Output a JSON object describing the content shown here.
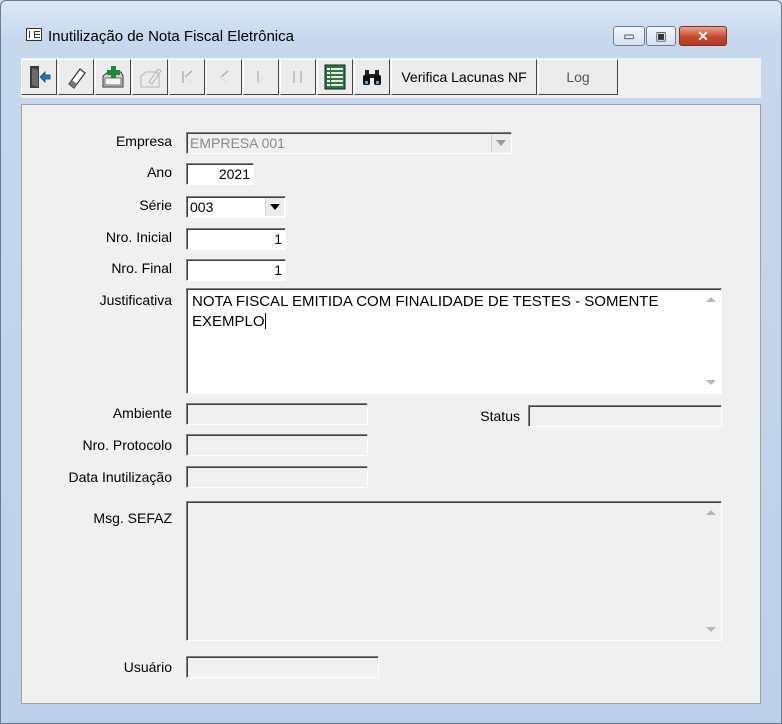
{
  "window": {
    "title": "Inutilização de Nota Fiscal Eletrônica",
    "min_glyph": "▭",
    "max_glyph": "▣",
    "close_glyph": "✕"
  },
  "toolbar": {
    "icons": [
      "exit-icon",
      "eraser-icon",
      "add-record-icon",
      "edit-icon",
      "first-record-icon",
      "prior-record-icon",
      "next-record-icon",
      "last-record-icon",
      "list-view-icon",
      "binoculars-icon"
    ],
    "verifica_label": "Verifica Lacunas NF",
    "log_label": "Log"
  },
  "form": {
    "empresa_label": "Empresa",
    "empresa_value": "EMPRESA 001",
    "ano_label": "Ano",
    "ano_value": "2021",
    "serie_label": "Série",
    "serie_value": "003",
    "nro_inicial_label": "Nro. Inicial",
    "nro_inicial_value": "1",
    "nro_final_label": "Nro. Final",
    "nro_final_value": "1",
    "justificativa_label": "Justificativa",
    "justificativa_value": "NOTA FISCAL EMITIDA COM FINALIDADE DE TESTES - SOMENTE EXEMPLO",
    "ambiente_label": "Ambiente",
    "ambiente_value": "",
    "status_label": "Status",
    "status_value": "",
    "protocolo_label": "Nro. Protocolo",
    "protocolo_value": "",
    "data_label": "Data Inutilização",
    "data_value": "",
    "msg_label": "Msg. SEFAZ",
    "msg_value": "",
    "usuario_label": "Usuário",
    "usuario_value": ""
  },
  "colors": {
    "window_frame": "#c6d8ee",
    "face": "#f0f0f0",
    "close_red": "#c7482d"
  }
}
